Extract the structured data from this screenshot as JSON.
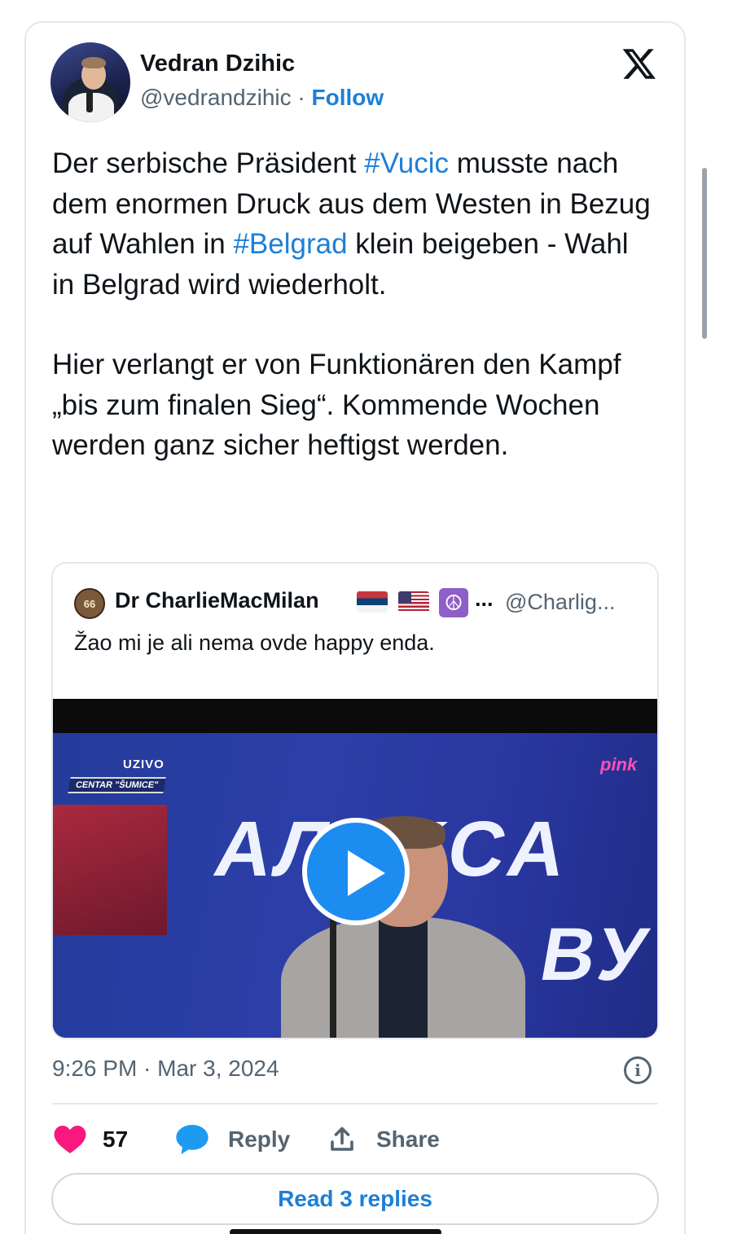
{
  "author": {
    "name": "Vedran Dzihic",
    "handle": "@vedrandzihic",
    "separator": "·",
    "follow_label": "Follow"
  },
  "tweet": {
    "paragraph1": [
      {
        "text": "Der serbische Präsident ",
        "hashtag": false
      },
      {
        "text": "#Vucic",
        "hashtag": true
      },
      {
        "text": " musste nach dem enormen Druck aus dem Westen in Bezug auf Wahlen in ",
        "hashtag": false
      },
      {
        "text": "#Belgrad",
        "hashtag": true
      },
      {
        "text": " klein beigeben - Wahl in Belgrad wird wiederholt.",
        "hashtag": false
      }
    ],
    "paragraph2": "Hier verlangt er von Funktionären den Kampf „bis zum finalen Sieg“. Kommende Wochen werden ganz sicher heftigst werden."
  },
  "quoted_tweet": {
    "avatar_text": "66",
    "name": "Dr CharlieMacMilan",
    "ellipsis": "...",
    "handle": "@Charlig...",
    "text": "Žao mi je ali nema ovde happy enda.",
    "video": {
      "overlay_live": "UZIVO",
      "overlay_location": "CENTAR \"ŠUMICE\"",
      "channel_logo": "pink",
      "backdrop_text_1": "AЛEKCA",
      "backdrop_text_2": "BУ"
    }
  },
  "meta": {
    "timestamp": "9:26 PM · Mar 3, 2024",
    "info_glyph": "i"
  },
  "actions": {
    "like_count": "57",
    "reply_label": "Reply",
    "share_label": "Share"
  },
  "read_replies_label": "Read 3 replies",
  "colors": {
    "link": "#1d7fd6",
    "like": "#f91880",
    "reply_bubble": "#1d9bf0",
    "muted": "#536471"
  },
  "icons": [
    "x-logo-icon",
    "heart-icon",
    "reply-bubble-icon",
    "share-icon",
    "info-icon",
    "play-icon"
  ]
}
